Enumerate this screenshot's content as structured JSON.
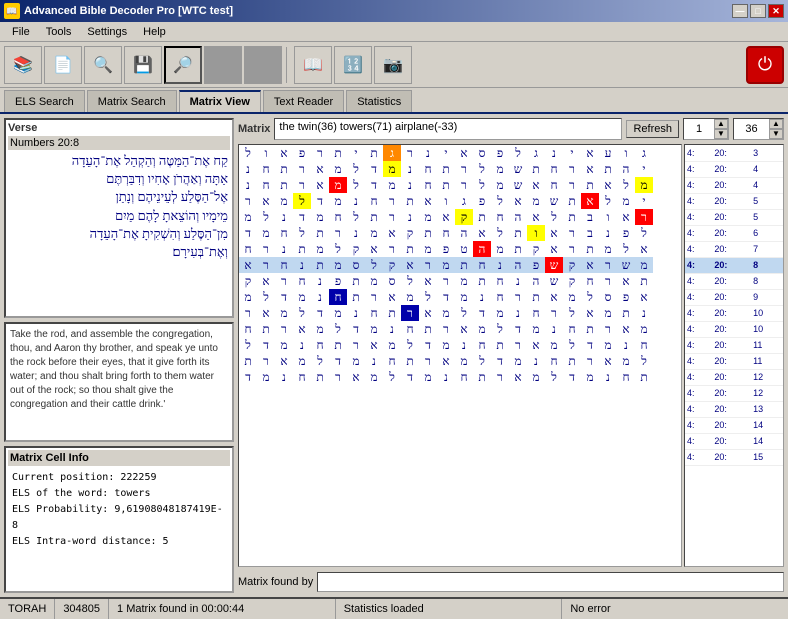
{
  "window": {
    "title": "Advanced Bible Decoder Pro [WTC test]",
    "icon": "📖"
  },
  "titlebar": {
    "minimize": "—",
    "maximize": "□",
    "close": "✕"
  },
  "menu": {
    "items": [
      "File",
      "Tools",
      "Settings",
      "Help"
    ]
  },
  "toolbar": {
    "icons": [
      "📚",
      "📄",
      "🔍",
      "💾",
      "🔎",
      "⬛",
      "⬛",
      "📖",
      "🔢",
      "📷"
    ],
    "power_icon": "⏻"
  },
  "tabs": {
    "items": [
      "ELS Search",
      "Matrix Search",
      "Matrix View",
      "Text Reader",
      "Statistics"
    ],
    "active": 2
  },
  "left_panel": {
    "verse_label": "Verse",
    "verse_ref": "Numbers 20:8",
    "verse_hebrew": "קַח אֶת־הַמַּטֶּה וְהַקְהֵל אֶת־הָעֵדָה\nאַתָּה וְאַהֲרֹן אָחִיו וְדִבַּרְתֶּם\nאֶל־הַסֶּלַע לְעֵינֵיהֶם וְנָתַן\nמֵימָיו וְהוֹצֵאתָ לָהֶם מַיִם\nמִן־הַסֶּלַע וְהִשְׁקִיתָ אֶת־הָעֵדָה\nוְאֶת־בְּעִירָם׃",
    "verse_english": "Take the rod, and assemble the congregation, thou, and Aaron thy brother, and speak ye unto the rock before their eyes, that it give forth its water; and thou shalt bring forth to them water out of the rock; so thou shalt give the congregation and their cattle drink.'",
    "matrix_cell_label": "Matrix Cell Info",
    "info_lines": [
      "Current position: 222259",
      "ELS of the word: towers",
      "ELS Probability: 9,61908048187419E-8",
      "ELS Intra-word distance:   5"
    ]
  },
  "matrix": {
    "label": "Matrix",
    "search_text": "the twin(36) towers(71) airplane(-33)",
    "refresh_label": "Refresh",
    "spin_value": "1",
    "spin_value2": "36",
    "found_label": "Matrix found by",
    "found_text": "",
    "grid": [
      [
        "ג",
        "ו",
        "ע",
        "א",
        "י",
        "נ",
        "ג",
        "ל",
        "פ",
        "ס",
        "א",
        "י",
        "נ",
        "ר",
        "ג",
        "ת",
        "י",
        "ת",
        "ר",
        "פ",
        "א",
        "ו",
        "ל"
      ],
      [
        "י",
        "ה",
        "ת",
        "א",
        "ר",
        "ח",
        "ת",
        "ש",
        "מ",
        "ל",
        "ר",
        "ת",
        "ח",
        "נ",
        "מ",
        "ד",
        "ל",
        "מ",
        "א",
        "ר",
        "ת",
        "ח",
        "נ"
      ],
      [
        "מ",
        "ל",
        "א",
        "ת",
        "ר",
        "ח",
        "א",
        "ש",
        "מ",
        "ל",
        "ר",
        "ת",
        "ח",
        "נ",
        "מ",
        "ד",
        "ל",
        "מ",
        "א",
        "ר",
        "ת",
        "ח",
        "נ"
      ],
      [
        "י",
        "מ",
        "ל",
        "א",
        "ת",
        "ש",
        "מ",
        "א",
        "ל",
        "פ",
        "ג",
        "ו",
        "א",
        "ת",
        "ר",
        "ח",
        "נ",
        "מ",
        "ד",
        "ל",
        "מ",
        "א",
        "ר"
      ],
      [
        "ר",
        "א",
        "ו",
        "ב",
        "ת",
        "ל",
        "א",
        "ה",
        "ח",
        "ת",
        "ק",
        "א",
        "מ",
        "נ",
        "ר",
        "ת",
        "ל",
        "ח",
        "מ",
        "ד",
        "נ",
        "ל",
        "מ"
      ],
      [
        "ל",
        "פ",
        "נ",
        "ב",
        "ר",
        "א",
        "ו",
        "ת",
        "ל",
        "א",
        "ה",
        "ח",
        "ת",
        "ק",
        "א",
        "מ",
        "נ",
        "ר",
        "ת",
        "ל",
        "ח",
        "מ",
        "ד"
      ],
      [
        "א",
        "ל",
        "מ",
        "ת",
        "ר",
        "א",
        "ק",
        "ת",
        "מ",
        "ה",
        "ט",
        "פ",
        "מ",
        "ת",
        "ר",
        "א",
        "ק",
        "ל",
        "מ",
        "ת",
        "נ",
        "ר",
        "ח"
      ],
      [
        "מ",
        "ש",
        "ר",
        "א",
        "ק",
        "ש",
        "פ",
        "ה",
        "נ",
        "ח",
        "ת",
        "מ",
        "ר",
        "א",
        "ק",
        "ל",
        "ס",
        "מ",
        "ת",
        "נ",
        "ח",
        "ר",
        "א"
      ],
      [
        "ת",
        "א",
        "ר",
        "ח",
        "ק",
        "ש",
        "ה",
        "נ",
        "ח",
        "ת",
        "מ",
        "ר",
        "א",
        "ל",
        "ס",
        "מ",
        "ת",
        "פ",
        "נ",
        "ח",
        "ר",
        "א",
        "ק"
      ],
      [
        "א",
        "פ",
        "ס",
        "ל",
        "מ",
        "א",
        "ת",
        "ר",
        "ח",
        "נ",
        "מ",
        "ד",
        "ל",
        "מ",
        "א",
        "ר",
        "ת",
        "ח",
        "נ",
        "מ",
        "ד",
        "ל",
        "מ"
      ],
      [
        "נ",
        "ת",
        "מ",
        "א",
        "ל",
        "ר",
        "ח",
        "נ",
        "מ",
        "ד",
        "ל",
        "מ",
        "א",
        "ר",
        "ת",
        "ח",
        "נ",
        "מ",
        "ד",
        "ל",
        "מ",
        "א",
        "ר"
      ],
      [
        "מ",
        "א",
        "ר",
        "ת",
        "ח",
        "נ",
        "מ",
        "ד",
        "ל",
        "מ",
        "א",
        "ר",
        "ת",
        "ח",
        "נ",
        "מ",
        "ד",
        "ל",
        "מ",
        "א",
        "ר",
        "ת",
        "ח"
      ],
      [
        "ח",
        "נ",
        "מ",
        "ד",
        "ל",
        "מ",
        "א",
        "ר",
        "ת",
        "ח",
        "נ",
        "מ",
        "ד",
        "ל",
        "מ",
        "א",
        "ר",
        "ת",
        "ח",
        "נ",
        "מ",
        "ד",
        "ל"
      ],
      [
        "ל",
        "מ",
        "א",
        "ר",
        "ת",
        "ח",
        "נ",
        "מ",
        "ד",
        "ל",
        "מ",
        "א",
        "ר",
        "ת",
        "ח",
        "נ",
        "מ",
        "ד",
        "ל",
        "מ",
        "א",
        "ר",
        "ת"
      ],
      [
        "ת",
        "ח",
        "נ",
        "מ",
        "ד",
        "ל",
        "מ",
        "א",
        "ר",
        "ת",
        "ח",
        "נ",
        "מ",
        "ד",
        "ל",
        "מ",
        "א",
        "ר",
        "ת",
        "ח",
        "נ",
        "מ",
        "ד"
      ]
    ],
    "highlights": [
      {
        "row": 1,
        "col": 14,
        "type": "yellow"
      },
      {
        "row": 2,
        "col": 0,
        "type": "yellow"
      },
      {
        "row": 3,
        "col": 19,
        "type": "yellow"
      },
      {
        "row": 4,
        "col": 10,
        "type": "yellow"
      },
      {
        "row": 5,
        "col": 6,
        "type": "yellow"
      },
      {
        "row": 2,
        "col": 17,
        "type": "red"
      },
      {
        "row": 3,
        "col": 3,
        "type": "red"
      },
      {
        "row": 4,
        "col": 0,
        "type": "red"
      },
      {
        "row": 6,
        "col": 9,
        "type": "red"
      },
      {
        "row": 7,
        "col": 5,
        "type": "red"
      },
      {
        "row": 9,
        "col": 17,
        "type": "blue"
      },
      {
        "row": 10,
        "col": 13,
        "type": "blue"
      },
      {
        "row": 0,
        "col": 14,
        "type": "orange"
      }
    ],
    "active_row": 7,
    "sidebar": [
      {
        "col1": "4:",
        "col2": "20:",
        "col3": "3"
      },
      {
        "col1": "4:",
        "col2": "20:",
        "col3": "4"
      },
      {
        "col1": "4:",
        "col2": "20:",
        "col3": "4"
      },
      {
        "col1": "4:",
        "col2": "20:",
        "col3": "5"
      },
      {
        "col1": "4:",
        "col2": "20:",
        "col3": "5"
      },
      {
        "col1": "4:",
        "col2": "20:",
        "col3": "6"
      },
      {
        "col1": "4:",
        "col2": "20:",
        "col3": "7"
      },
      {
        "col1": "4:",
        "col2": "20:",
        "col3": "8",
        "active": true
      },
      {
        "col1": "4:",
        "col2": "20:",
        "col3": "8"
      },
      {
        "col1": "4:",
        "col2": "20:",
        "col3": "9"
      },
      {
        "col1": "4:",
        "col2": "20:",
        "col3": "10"
      },
      {
        "col1": "4:",
        "col2": "20:",
        "col3": "10"
      },
      {
        "col1": "4:",
        "col2": "20:",
        "col3": "11"
      },
      {
        "col1": "4:",
        "col2": "20:",
        "col3": "11"
      },
      {
        "col1": "4:",
        "col2": "20:",
        "col3": "12"
      },
      {
        "col1": "4:",
        "col2": "20:",
        "col3": "12"
      },
      {
        "col1": "4:",
        "col2": "20:",
        "col3": "13"
      },
      {
        "col1": "4:",
        "col2": "20:",
        "col3": "14"
      },
      {
        "col1": "4:",
        "col2": "20:",
        "col3": "14"
      },
      {
        "col1": "4:",
        "col2": "20:",
        "col3": "15"
      }
    ]
  },
  "statusbar": {
    "torah": "TORAH",
    "count": "304805",
    "matrix_found": "1 Matrix found in 00:00:44",
    "stats": "Statistics loaded",
    "error": "No error"
  }
}
